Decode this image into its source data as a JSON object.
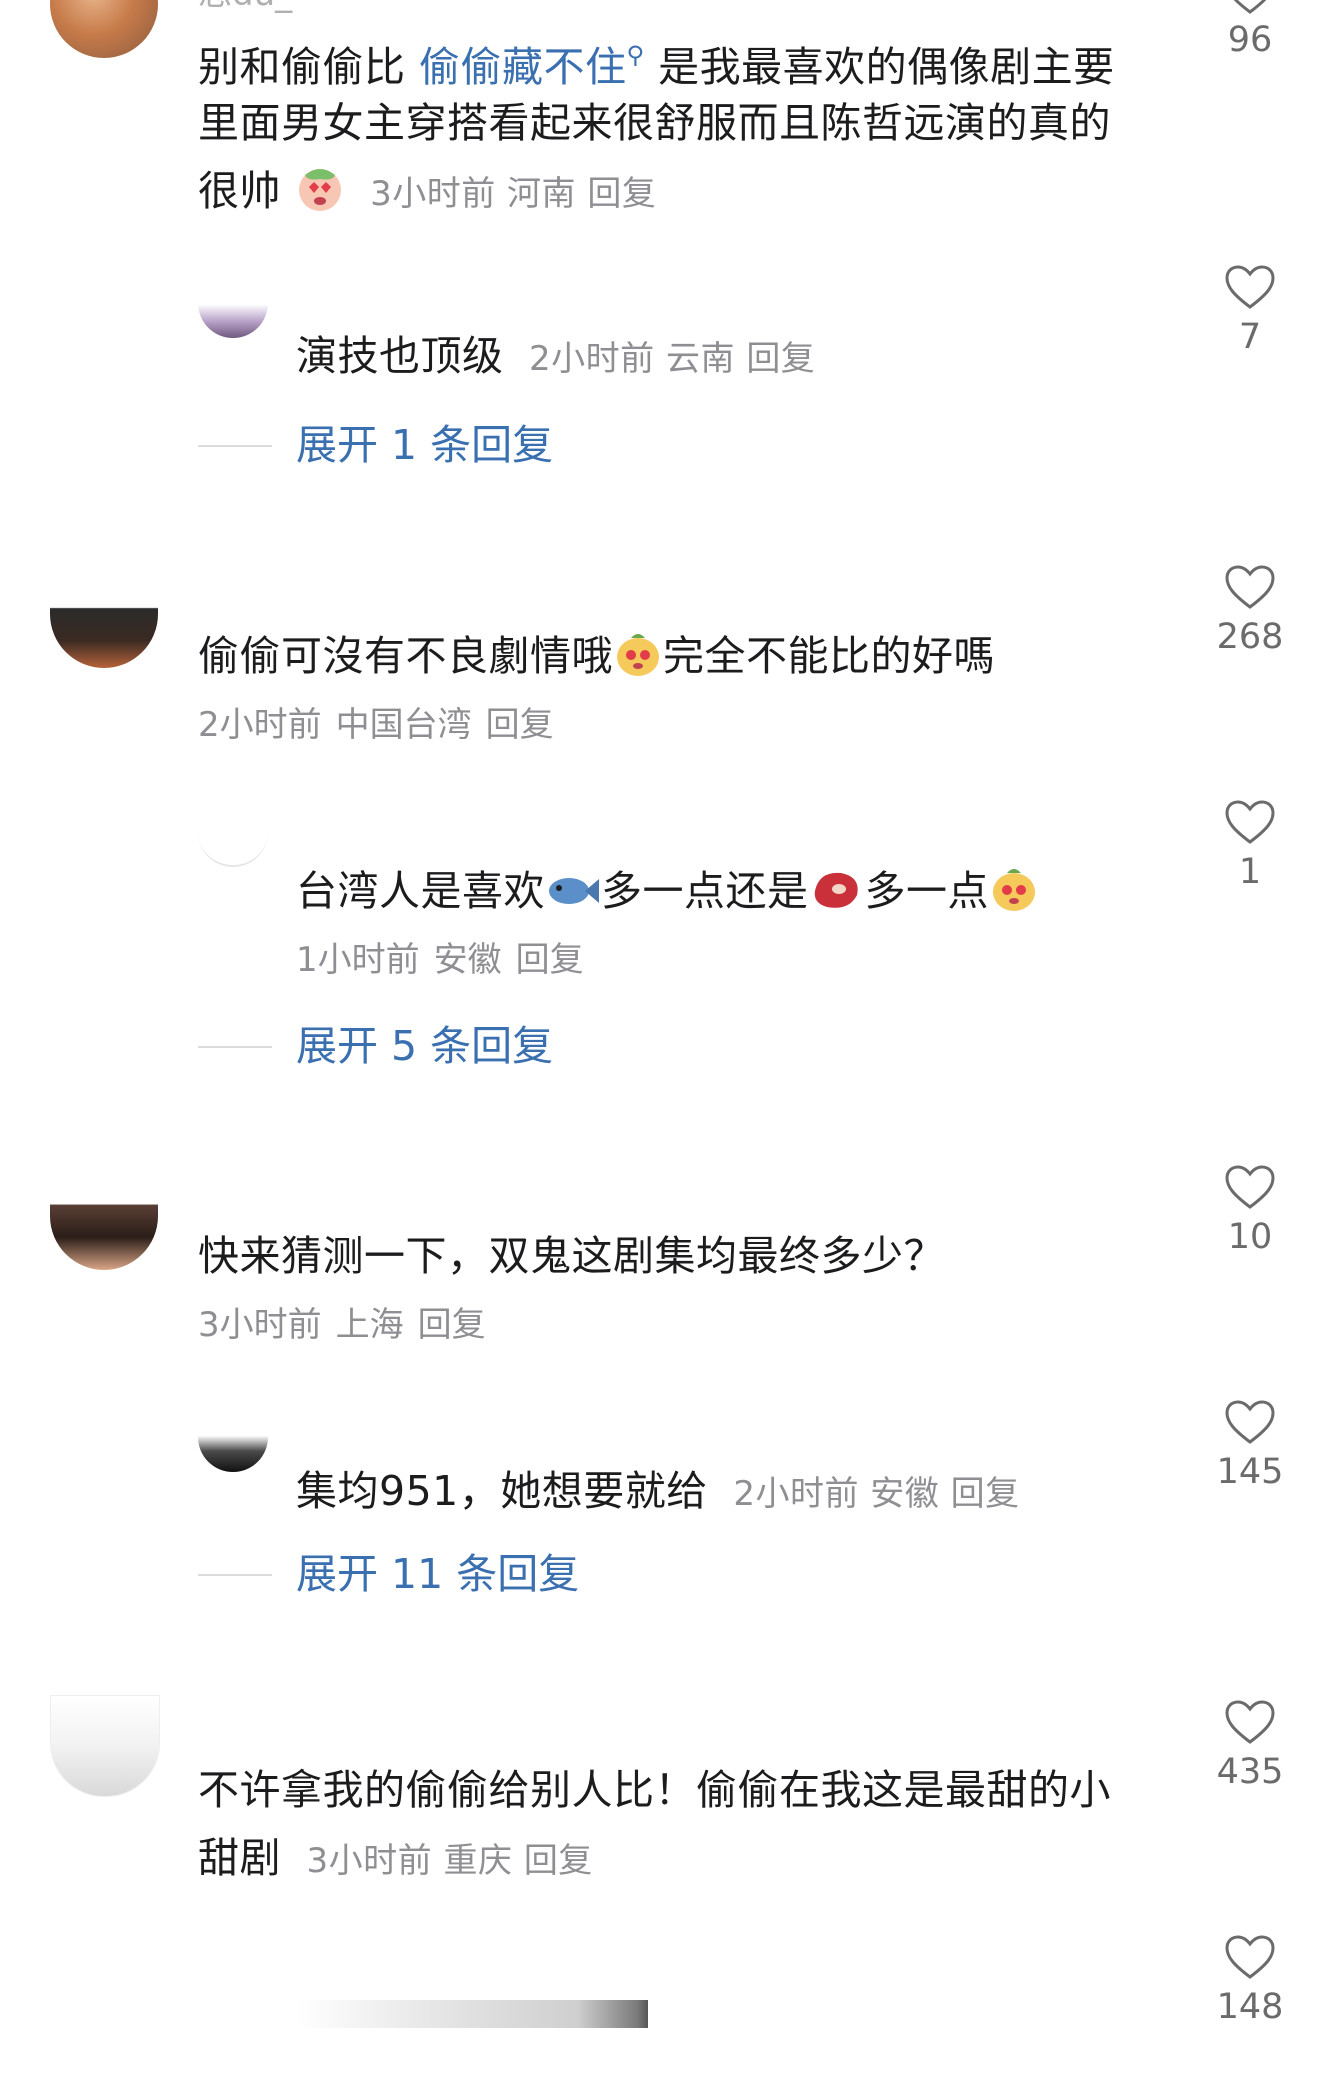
{
  "comments": [
    {
      "username_partial": "思du_",
      "segments": [
        "别和偷偷比 ",
        "偷偷藏不住",
        " 是我最喜欢的偶像剧主要",
        "里面男女主穿搭看起来很舒服而且陈哲远演的真的",
        "很帅"
      ],
      "time": "3小时前",
      "location": "河南",
      "reply_label": "回复",
      "likes": "96",
      "reply": {
        "text": "演技也顶级",
        "time": "2小时前",
        "location": "云南",
        "reply_label": "回复",
        "likes": "7"
      },
      "expand": "展开 1 条回复"
    },
    {
      "segments": [
        "偷偷可沒有不良劇情哦",
        "完全不能比的好嗎"
      ],
      "time": "2小时前",
      "location": "中国台湾",
      "reply_label": "回复",
      "likes": "268",
      "reply": {
        "segments": [
          "台湾人是喜欢",
          "多一点还是",
          "多一点"
        ],
        "time": "1小时前",
        "location": "安徽",
        "reply_label": "回复",
        "likes": "1"
      },
      "expand": "展开 5 条回复"
    },
    {
      "text": "快来猜测一下，双鬼这剧集均最终多少？",
      "time": "3小时前",
      "location": "上海",
      "reply_label": "回复",
      "likes": "10",
      "reply": {
        "text": "集均951，她想要就给",
        "time": "2小时前",
        "location": "安徽",
        "reply_label": "回复",
        "likes": "145"
      },
      "expand": "展开 11 条回复"
    },
    {
      "segments": [
        "不许拿我的偷偷给别人比！偷偷在我这是最甜的小",
        "甜剧"
      ],
      "time": "3小时前",
      "location": "重庆",
      "reply_label": "回复",
      "likes": "435"
    },
    {
      "likes": "148"
    }
  ],
  "icons": {
    "like": "heart-outline-icon",
    "search": "search-icon"
  },
  "colors": {
    "link": "#3a6fb0",
    "meta": "#8e8e93",
    "text": "#1c1c1e"
  }
}
